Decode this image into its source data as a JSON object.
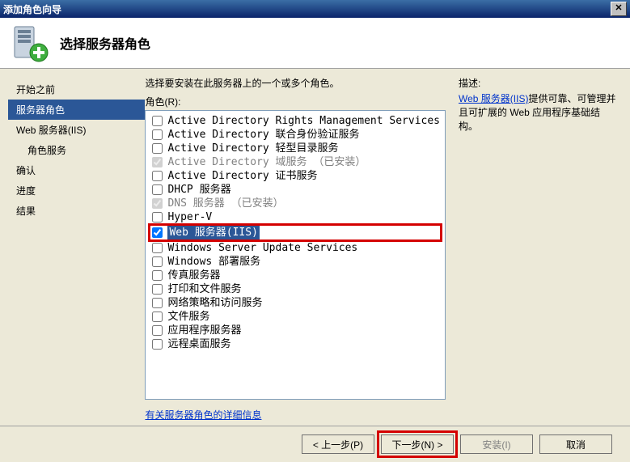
{
  "window": {
    "title": "添加角色向导"
  },
  "header": {
    "title": "选择服务器角色"
  },
  "sidebar": {
    "items": [
      {
        "label": "开始之前"
      },
      {
        "label": "服务器角色"
      },
      {
        "label": "Web 服务器(IIS)"
      },
      {
        "label": "角色服务"
      },
      {
        "label": "确认"
      },
      {
        "label": "进度"
      },
      {
        "label": "结果"
      }
    ]
  },
  "main": {
    "intro": "选择要安装在此服务器上的一个或多个角色。",
    "roles_label": "角色(R):",
    "roles": [
      {
        "label": "Active Directory Rights Management Services",
        "checked": false,
        "disabled": false
      },
      {
        "label": "Active Directory 联合身份验证服务",
        "checked": false,
        "disabled": false
      },
      {
        "label": "Active Directory 轻型目录服务",
        "checked": false,
        "disabled": false
      },
      {
        "label": "Active Directory 域服务 （已安装）",
        "checked": true,
        "disabled": true
      },
      {
        "label": "Active Directory 证书服务",
        "checked": false,
        "disabled": false
      },
      {
        "label": "DHCP 服务器",
        "checked": false,
        "disabled": false
      },
      {
        "label": "DNS 服务器 （已安装）",
        "checked": true,
        "disabled": true
      },
      {
        "label": "Hyper-V",
        "checked": false,
        "disabled": false
      },
      {
        "label": "Web 服务器(IIS)",
        "checked": true,
        "disabled": false,
        "highlight": true
      },
      {
        "label": "Windows Server Update Services",
        "checked": false,
        "disabled": false
      },
      {
        "label": "Windows 部署服务",
        "checked": false,
        "disabled": false
      },
      {
        "label": "传真服务器",
        "checked": false,
        "disabled": false
      },
      {
        "label": "打印和文件服务",
        "checked": false,
        "disabled": false
      },
      {
        "label": "网络策略和访问服务",
        "checked": false,
        "disabled": false
      },
      {
        "label": "文件服务",
        "checked": false,
        "disabled": false
      },
      {
        "label": "应用程序服务器",
        "checked": false,
        "disabled": false
      },
      {
        "label": "远程桌面服务",
        "checked": false,
        "disabled": false
      }
    ],
    "more_info": "有关服务器角色的详细信息"
  },
  "right": {
    "desc_title": "描述:",
    "link_text": "Web 服务器(IIS)",
    "desc_body": "提供可靠、可管理并且可扩展的 Web 应用程序基础结构。"
  },
  "footer": {
    "prev": "< 上一步(P)",
    "next": "下一步(N) >",
    "install": "安装(I)",
    "cancel": "取消"
  }
}
